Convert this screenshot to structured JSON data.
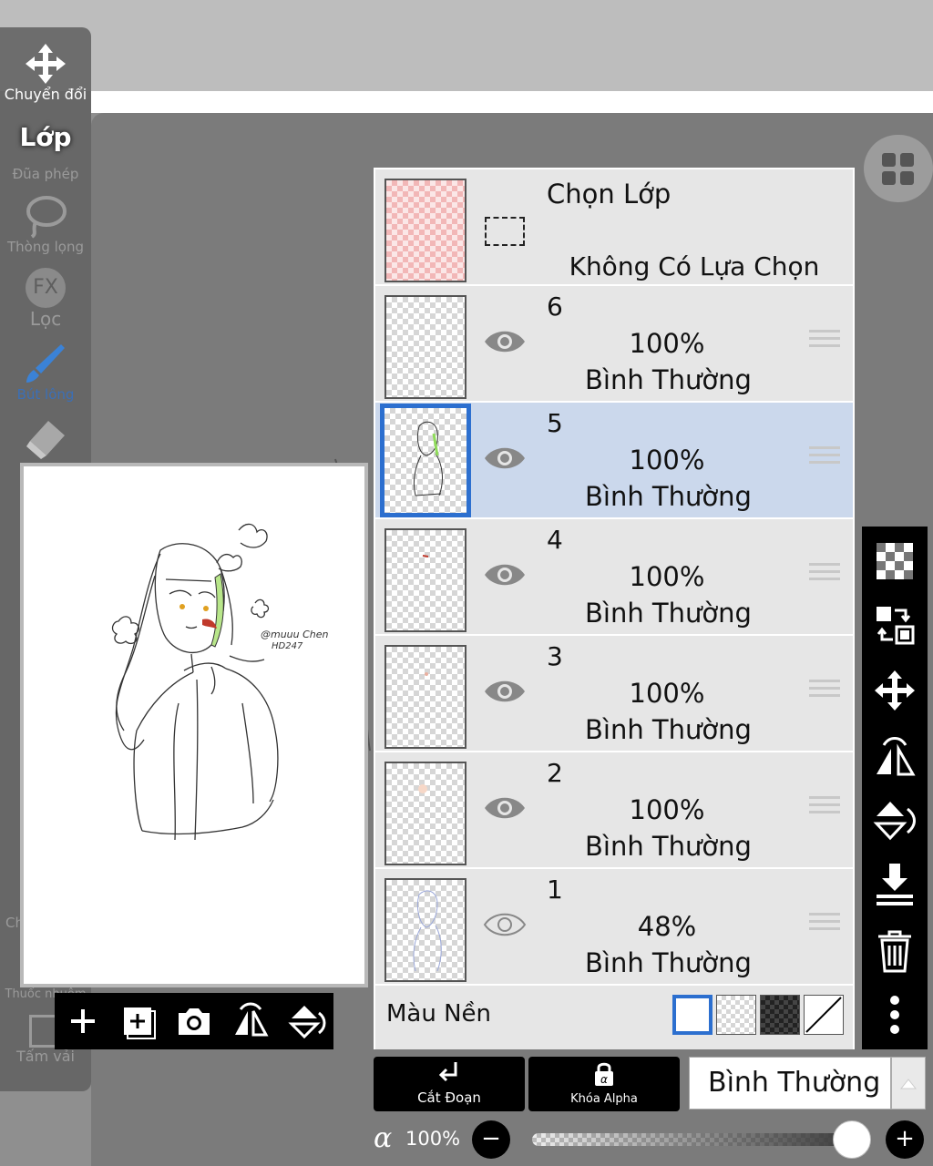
{
  "left_toolbar": {
    "transform_label": "Chuyển đổi",
    "layer_label": "Lớp",
    "magic_wand_label": "Đũa phép",
    "lasso_label": "Thòng lọng",
    "filter_label": "Lọc",
    "filter_icon_text": "FX",
    "brush_label": "Bút lông",
    "fill_label": "Thuốc nhuộm",
    "canvas_label": "Tấm vải",
    "partial_labels": [
      "T",
      "L",
      "B",
      "V",
      "Ch"
    ]
  },
  "canvas_signature": [
    "@muuu Chen",
    "HD247"
  ],
  "layers_panel": {
    "selection_layer": {
      "title": "Chọn Lớp",
      "status": "Không Có Lựa Chọn"
    },
    "layers": [
      {
        "number": "6",
        "opacity": "100%",
        "mode": "Bình Thường",
        "visible": true,
        "selected": false
      },
      {
        "number": "5",
        "opacity": "100%",
        "mode": "Bình Thường",
        "visible": true,
        "selected": true
      },
      {
        "number": "4",
        "opacity": "100%",
        "mode": "Bình Thường",
        "visible": true,
        "selected": false
      },
      {
        "number": "3",
        "opacity": "100%",
        "mode": "Bình Thường",
        "visible": true,
        "selected": false
      },
      {
        "number": "2",
        "opacity": "100%",
        "mode": "Bình Thường",
        "visible": true,
        "selected": false
      },
      {
        "number": "1",
        "opacity": "48%",
        "mode": "Bình Thường",
        "visible": false,
        "selected": false
      }
    ],
    "background": {
      "label": "Màu Nền"
    }
  },
  "bottom_bar": {
    "clipping_label": "Cắt Đoạn",
    "alpha_lock_label": "Khóa Alpha",
    "blend_mode": "Bình Thường",
    "alpha_symbol": "α",
    "opacity_value": "100%",
    "opacity_level": 1.0,
    "minus": "−",
    "plus": "+"
  },
  "colors": {
    "selected_layer_bg": "#cbd8ec",
    "selected_border": "#2c6fcf",
    "toolbar_black": "#000000",
    "brush_blue": "#3b82d6"
  }
}
